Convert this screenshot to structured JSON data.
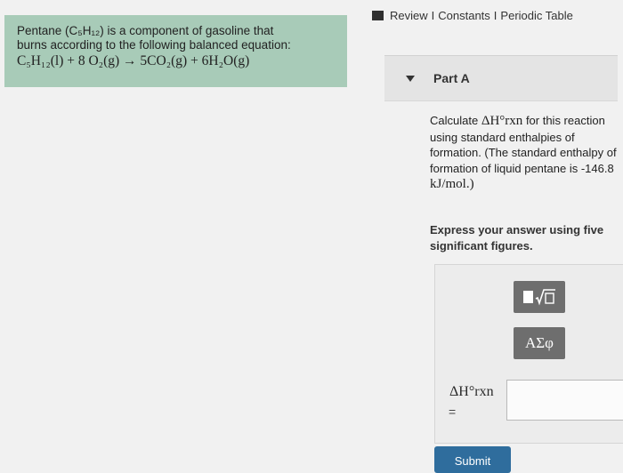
{
  "intro": {
    "line1": "Pentane (C₅H₁₂) is a component of gasoline that",
    "line2": "burns according to the following balanced equation:",
    "equation": "C₅H₁₂(l) + 8 O₂(g) → 5CO₂(g) + 6H₂O(g)"
  },
  "nav": {
    "review": "Review",
    "constants": "Constants",
    "periodic_table": "Periodic Table",
    "separator": "I"
  },
  "part": {
    "title": "Part A"
  },
  "question": {
    "prefix": "Calculate",
    "symbol": "ΔH°rxn",
    "rest": "for this reaction using standard enthalpies of formation. (The standard enthalpy of formation of liquid pentane is -146.8",
    "unit": "kJ/mol.)"
  },
  "instruction": "Express your answer using five significant figures.",
  "tools": {
    "template_icon": "template-icon",
    "greek": "ΑΣφ"
  },
  "answer": {
    "label": "ΔH°rxn",
    "equals": "=",
    "value": ""
  },
  "submit": "Submit",
  "colors": {
    "intro_bg": "#a8cbb8",
    "button_gray": "#6e6e6e",
    "submit_blue": "#2f6d9d"
  }
}
